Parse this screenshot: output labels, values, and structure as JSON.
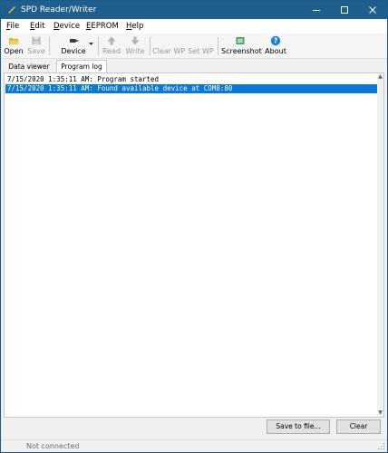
{
  "window": {
    "title": "SPD Reader/Writer"
  },
  "menu": {
    "items": [
      {
        "underline": "F",
        "rest": "ile"
      },
      {
        "underline": "E",
        "rest": "dit"
      },
      {
        "underline": "D",
        "rest": "evice"
      },
      {
        "underline": "E",
        "rest": "EPROM"
      },
      {
        "underline": "H",
        "rest": "elp"
      }
    ]
  },
  "toolbar": {
    "open": "Open",
    "save": "Save",
    "device": "Device",
    "read": "Read",
    "write": "Write",
    "clear_wp": "Clear WP",
    "set_wp": "Set WP",
    "screenshot": "Screenshot",
    "about": "About"
  },
  "tabs": [
    "Data viewer",
    "Program log"
  ],
  "log": [
    "7/15/2020 1:35:11 AM: Program started",
    "7/15/2020 1:35:11 AM: Found available device at COM8:80"
  ],
  "buttons": {
    "save_to_file": "Save to file...",
    "clear": "Clear"
  },
  "status": {
    "text": "Not connected"
  },
  "colors": {
    "titlebar": "#1f5f8e",
    "selection": "#0a78d7",
    "about_icon": "#1e7fd8"
  }
}
